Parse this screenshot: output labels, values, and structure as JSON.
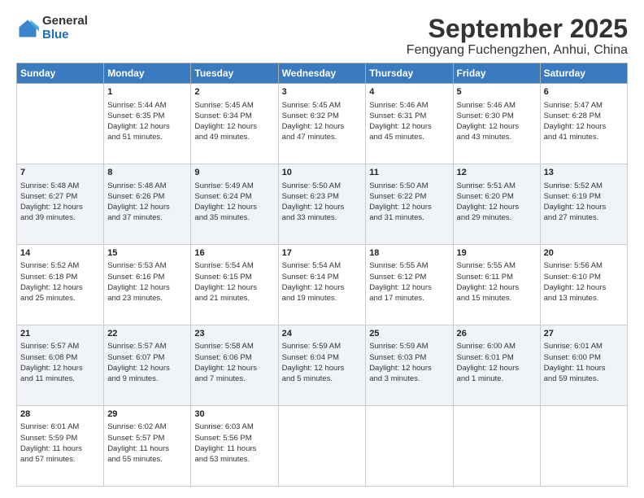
{
  "header": {
    "logo_general": "General",
    "logo_blue": "Blue",
    "main_title": "September 2025",
    "sub_title": "Fengyang Fuchengzhen, Anhui, China"
  },
  "columns": [
    "Sunday",
    "Monday",
    "Tuesday",
    "Wednesday",
    "Thursday",
    "Friday",
    "Saturday"
  ],
  "rows": [
    [
      {
        "day": "",
        "lines": []
      },
      {
        "day": "1",
        "lines": [
          "Sunrise: 5:44 AM",
          "Sunset: 6:35 PM",
          "Daylight: 12 hours",
          "and 51 minutes."
        ]
      },
      {
        "day": "2",
        "lines": [
          "Sunrise: 5:45 AM",
          "Sunset: 6:34 PM",
          "Daylight: 12 hours",
          "and 49 minutes."
        ]
      },
      {
        "day": "3",
        "lines": [
          "Sunrise: 5:45 AM",
          "Sunset: 6:32 PM",
          "Daylight: 12 hours",
          "and 47 minutes."
        ]
      },
      {
        "day": "4",
        "lines": [
          "Sunrise: 5:46 AM",
          "Sunset: 6:31 PM",
          "Daylight: 12 hours",
          "and 45 minutes."
        ]
      },
      {
        "day": "5",
        "lines": [
          "Sunrise: 5:46 AM",
          "Sunset: 6:30 PM",
          "Daylight: 12 hours",
          "and 43 minutes."
        ]
      },
      {
        "day": "6",
        "lines": [
          "Sunrise: 5:47 AM",
          "Sunset: 6:28 PM",
          "Daylight: 12 hours",
          "and 41 minutes."
        ]
      }
    ],
    [
      {
        "day": "7",
        "lines": [
          "Sunrise: 5:48 AM",
          "Sunset: 6:27 PM",
          "Daylight: 12 hours",
          "and 39 minutes."
        ]
      },
      {
        "day": "8",
        "lines": [
          "Sunrise: 5:48 AM",
          "Sunset: 6:26 PM",
          "Daylight: 12 hours",
          "and 37 minutes."
        ]
      },
      {
        "day": "9",
        "lines": [
          "Sunrise: 5:49 AM",
          "Sunset: 6:24 PM",
          "Daylight: 12 hours",
          "and 35 minutes."
        ]
      },
      {
        "day": "10",
        "lines": [
          "Sunrise: 5:50 AM",
          "Sunset: 6:23 PM",
          "Daylight: 12 hours",
          "and 33 minutes."
        ]
      },
      {
        "day": "11",
        "lines": [
          "Sunrise: 5:50 AM",
          "Sunset: 6:22 PM",
          "Daylight: 12 hours",
          "and 31 minutes."
        ]
      },
      {
        "day": "12",
        "lines": [
          "Sunrise: 5:51 AM",
          "Sunset: 6:20 PM",
          "Daylight: 12 hours",
          "and 29 minutes."
        ]
      },
      {
        "day": "13",
        "lines": [
          "Sunrise: 5:52 AM",
          "Sunset: 6:19 PM",
          "Daylight: 12 hours",
          "and 27 minutes."
        ]
      }
    ],
    [
      {
        "day": "14",
        "lines": [
          "Sunrise: 5:52 AM",
          "Sunset: 6:18 PM",
          "Daylight: 12 hours",
          "and 25 minutes."
        ]
      },
      {
        "day": "15",
        "lines": [
          "Sunrise: 5:53 AM",
          "Sunset: 6:16 PM",
          "Daylight: 12 hours",
          "and 23 minutes."
        ]
      },
      {
        "day": "16",
        "lines": [
          "Sunrise: 5:54 AM",
          "Sunset: 6:15 PM",
          "Daylight: 12 hours",
          "and 21 minutes."
        ]
      },
      {
        "day": "17",
        "lines": [
          "Sunrise: 5:54 AM",
          "Sunset: 6:14 PM",
          "Daylight: 12 hours",
          "and 19 minutes."
        ]
      },
      {
        "day": "18",
        "lines": [
          "Sunrise: 5:55 AM",
          "Sunset: 6:12 PM",
          "Daylight: 12 hours",
          "and 17 minutes."
        ]
      },
      {
        "day": "19",
        "lines": [
          "Sunrise: 5:55 AM",
          "Sunset: 6:11 PM",
          "Daylight: 12 hours",
          "and 15 minutes."
        ]
      },
      {
        "day": "20",
        "lines": [
          "Sunrise: 5:56 AM",
          "Sunset: 6:10 PM",
          "Daylight: 12 hours",
          "and 13 minutes."
        ]
      }
    ],
    [
      {
        "day": "21",
        "lines": [
          "Sunrise: 5:57 AM",
          "Sunset: 6:08 PM",
          "Daylight: 12 hours",
          "and 11 minutes."
        ]
      },
      {
        "day": "22",
        "lines": [
          "Sunrise: 5:57 AM",
          "Sunset: 6:07 PM",
          "Daylight: 12 hours",
          "and 9 minutes."
        ]
      },
      {
        "day": "23",
        "lines": [
          "Sunrise: 5:58 AM",
          "Sunset: 6:06 PM",
          "Daylight: 12 hours",
          "and 7 minutes."
        ]
      },
      {
        "day": "24",
        "lines": [
          "Sunrise: 5:59 AM",
          "Sunset: 6:04 PM",
          "Daylight: 12 hours",
          "and 5 minutes."
        ]
      },
      {
        "day": "25",
        "lines": [
          "Sunrise: 5:59 AM",
          "Sunset: 6:03 PM",
          "Daylight: 12 hours",
          "and 3 minutes."
        ]
      },
      {
        "day": "26",
        "lines": [
          "Sunrise: 6:00 AM",
          "Sunset: 6:01 PM",
          "Daylight: 12 hours",
          "and 1 minute."
        ]
      },
      {
        "day": "27",
        "lines": [
          "Sunrise: 6:01 AM",
          "Sunset: 6:00 PM",
          "Daylight: 11 hours",
          "and 59 minutes."
        ]
      }
    ],
    [
      {
        "day": "28",
        "lines": [
          "Sunrise: 6:01 AM",
          "Sunset: 5:59 PM",
          "Daylight: 11 hours",
          "and 57 minutes."
        ]
      },
      {
        "day": "29",
        "lines": [
          "Sunrise: 6:02 AM",
          "Sunset: 5:57 PM",
          "Daylight: 11 hours",
          "and 55 minutes."
        ]
      },
      {
        "day": "30",
        "lines": [
          "Sunrise: 6:03 AM",
          "Sunset: 5:56 PM",
          "Daylight: 11 hours",
          "and 53 minutes."
        ]
      },
      {
        "day": "",
        "lines": []
      },
      {
        "day": "",
        "lines": []
      },
      {
        "day": "",
        "lines": []
      },
      {
        "day": "",
        "lines": []
      }
    ]
  ]
}
